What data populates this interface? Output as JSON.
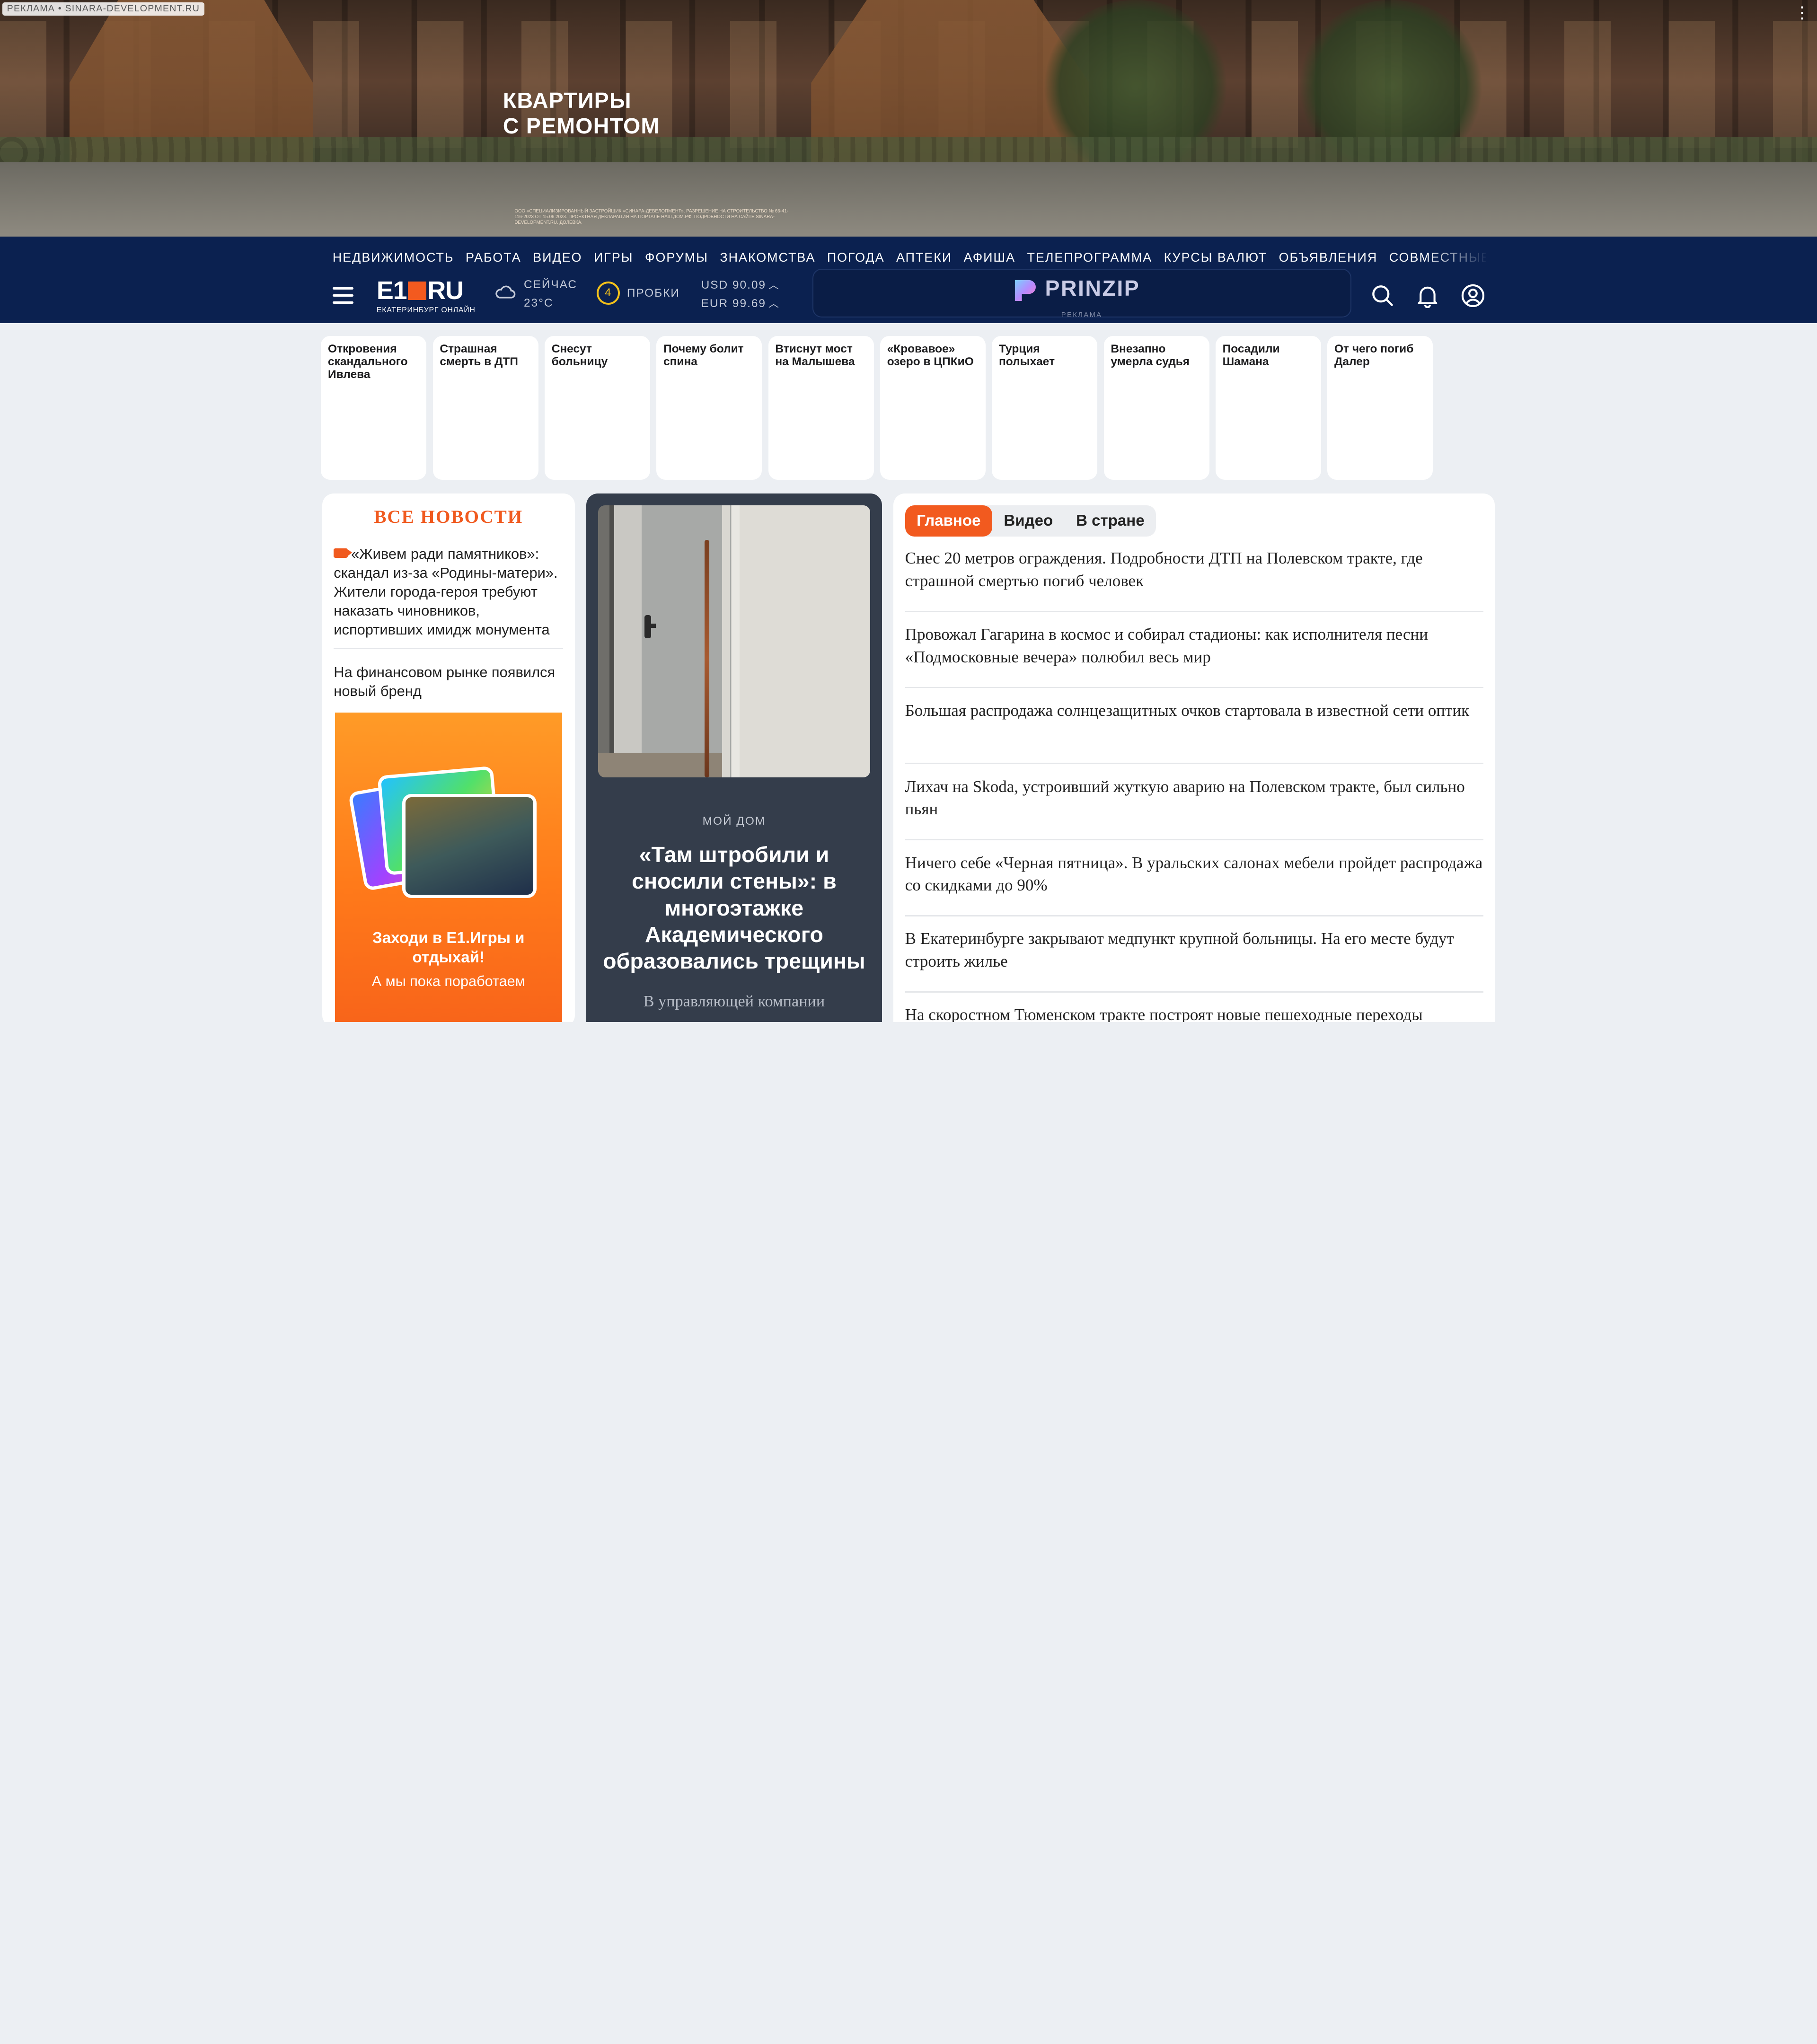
{
  "ad_banner": {
    "label": "РЕКЛАМА • SINARA-DEVELOPMENT.RU",
    "headline_line1": "КВАРТИРЫ",
    "headline_line2": "С РЕМОНТОМ",
    "fine_print": "ООО «СПЕЦИАЛИЗИРОВАННЫЙ ЗАСТРОЙЩИК «СИНАРА-ДЕВЕЛОПМЕНТ». РАЗРЕШЕНИЕ НА СТРОИТЕЛЬСТВО № 66-41-116-2023 ОТ 15.06.2023. ПРОЕКТНАЯ ДЕКЛАРАЦИЯ НА ПОРТАЛЕ НАШ.ДОМ.РФ. ПОДРОБНОСТИ НА САЙТЕ SINARA-DEVELOPMENT.RU. ДОЛЕВКА."
  },
  "nav": {
    "items": [
      "НЕДВИЖИМОСТЬ",
      "РАБОТА",
      "ВИДЕО",
      "ИГРЫ",
      "ФОРУМЫ",
      "ЗНАКОМСТВА",
      "ПОГОДА",
      "АПТЕКИ",
      "АФИША",
      "ТЕЛЕПРОГРАММА",
      "КУРСЫ ВАЛЮТ",
      "ОБЪЯВЛЕНИЯ",
      "СОВМЕСТНЫЕ ПОКУПКИ"
    ]
  },
  "header": {
    "logo_left": "E1",
    "logo_right": "RU",
    "logo_sub": "ЕКАТЕРИНБУРГ ОНЛАЙН",
    "weather_label": "СЕЙЧАС",
    "weather_temp": "23°C",
    "traffic_level": "4",
    "traffic_label": "ПРОБКИ",
    "usd": "USD 90.09",
    "eur": "EUR 99.69",
    "rate_trend_icon": "arrow-up-icon",
    "partner_name": "PRINZIP",
    "partner_ad_label": "РЕКЛАМА"
  },
  "stories": [
    "Откровения скандального Ивлева",
    "Страшная смерть в ДТП",
    "Снесут больницу",
    "Почему болит спина",
    "Втиснут мост на Малышева",
    "«Кровавое» озеро в ЦПКиО",
    "Турция полыхает",
    "Внезапно умерла судья",
    "Посадили Шамана",
    "От чего погиб Далер"
  ],
  "all_news": {
    "title": "ВСЕ НОВОСТИ",
    "items": [
      {
        "text": "«Живем ради памятников»: скандал из-за «Родины-матери». Жители города-героя требуют наказать чиновников, испортивших имидж монумента",
        "icon": "video-icon"
      },
      {
        "text": "На финансовом рынке появился новый бренд"
      }
    ],
    "promo": {
      "title": "Заходи в Е1.Игры и отдыхай!",
      "subtitle": "А мы пока поработаем"
    }
  },
  "featured": {
    "rubric": "МОЙ ДОМ",
    "title": "«Там штробили и сносили стены»: в многоэтажке Академического образовались трещины",
    "lead": "В управляющей компании"
  },
  "headlines": {
    "tabs": [
      "Главное",
      "Видео",
      "В стране"
    ],
    "active_tab": 0,
    "items": [
      "Снес 20 метров ограждения. Подробности ДТП на Полевском тракте, где страшной смертью погиб человек",
      "Провожал Гагарина в космос и собирал стадионы: как исполнителя песни «Подмосковные вечера» полюбил весь мир",
      "Большая распродажа солнцезащитных очков стартовала в известной сети оптик",
      "Лихач на Skoda, устроивший жуткую аварию на Полевском тракте, был сильно пьян",
      "Ничего себе «Черная пятница». В уральских салонах мебели пройдет распродажа со скидками до 90%",
      "В Екатеринбурге закрывают медпункт крупной больницы. На его месте будут строить жилье",
      "На скоростном Тюменском тракте построят новые пешеходные переходы"
    ]
  },
  "colors": {
    "header_bg": "#0b2150",
    "accent": "#f25a1f",
    "page_bg": "#eceff3",
    "featured_bg": "#343d4b"
  }
}
